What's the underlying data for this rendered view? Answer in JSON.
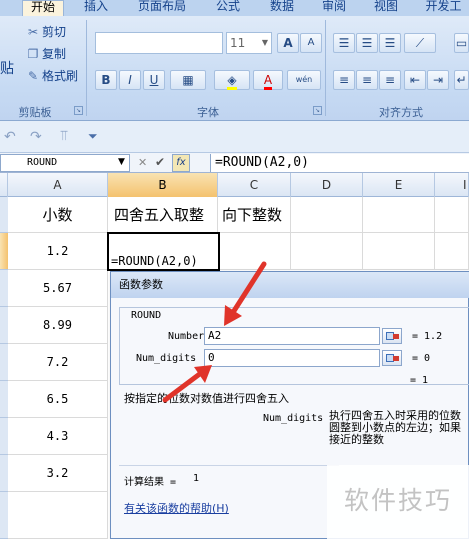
{
  "ribbon": {
    "tabs": [
      "开始",
      "插入",
      "页面布局",
      "公式",
      "数据",
      "审阅",
      "视图",
      "开发工"
    ],
    "active_tab": "开始",
    "clipboard": {
      "paste_label": "贴",
      "cut_label": "剪切",
      "copy_label": "复制",
      "format_painter_label": "格式刷",
      "group_label": "剪贴板"
    },
    "font": {
      "font_size": "11",
      "grow_label": "A",
      "shrink_label": "A",
      "bold": "B",
      "italic": "I",
      "underline": "U",
      "font_color": "A",
      "wen_label": "wén",
      "group_label": "字体"
    },
    "alignment": {
      "group_label": "对齐方式"
    }
  },
  "formula_bar": {
    "name_box": "ROUND",
    "fx_label": "fx",
    "formula": "=ROUND(A2,0)"
  },
  "grid": {
    "columns": [
      "A",
      "B",
      "C",
      "D",
      "E",
      "I"
    ],
    "selected_column": "B",
    "header_row": [
      "小数",
      "四舍五入取整",
      "向下整数"
    ],
    "values": [
      "1.2",
      "5.67",
      "8.99",
      "7.2",
      "6.5",
      "4.3",
      "3.2"
    ],
    "active_cell_content": "=ROUND(A2,0)"
  },
  "dialog": {
    "title": "函数参数",
    "function_name": "ROUND",
    "args": [
      {
        "label": "Number",
        "value": "A2",
        "result": "= 1.2"
      },
      {
        "label": "Num_digits",
        "value": "0",
        "result": "= 0"
      }
    ],
    "overall_result": "= 1",
    "description": "按指定的位数对数值进行四舍五入",
    "param_name": "Num_digits",
    "param_desc": [
      "执行四舍五入时采用的位数",
      "圆整到小数点的左边；如果",
      "接近的整数"
    ],
    "calc_result_label": "计算结果 =",
    "calc_result_value": "1",
    "help_link": "有关该函数的帮助(H)"
  },
  "watermark": "软件技巧",
  "colors": {
    "ribbon": "#c6daf3",
    "selected_header": "#f4c26e",
    "annotation_arrow": "#e0342a"
  }
}
